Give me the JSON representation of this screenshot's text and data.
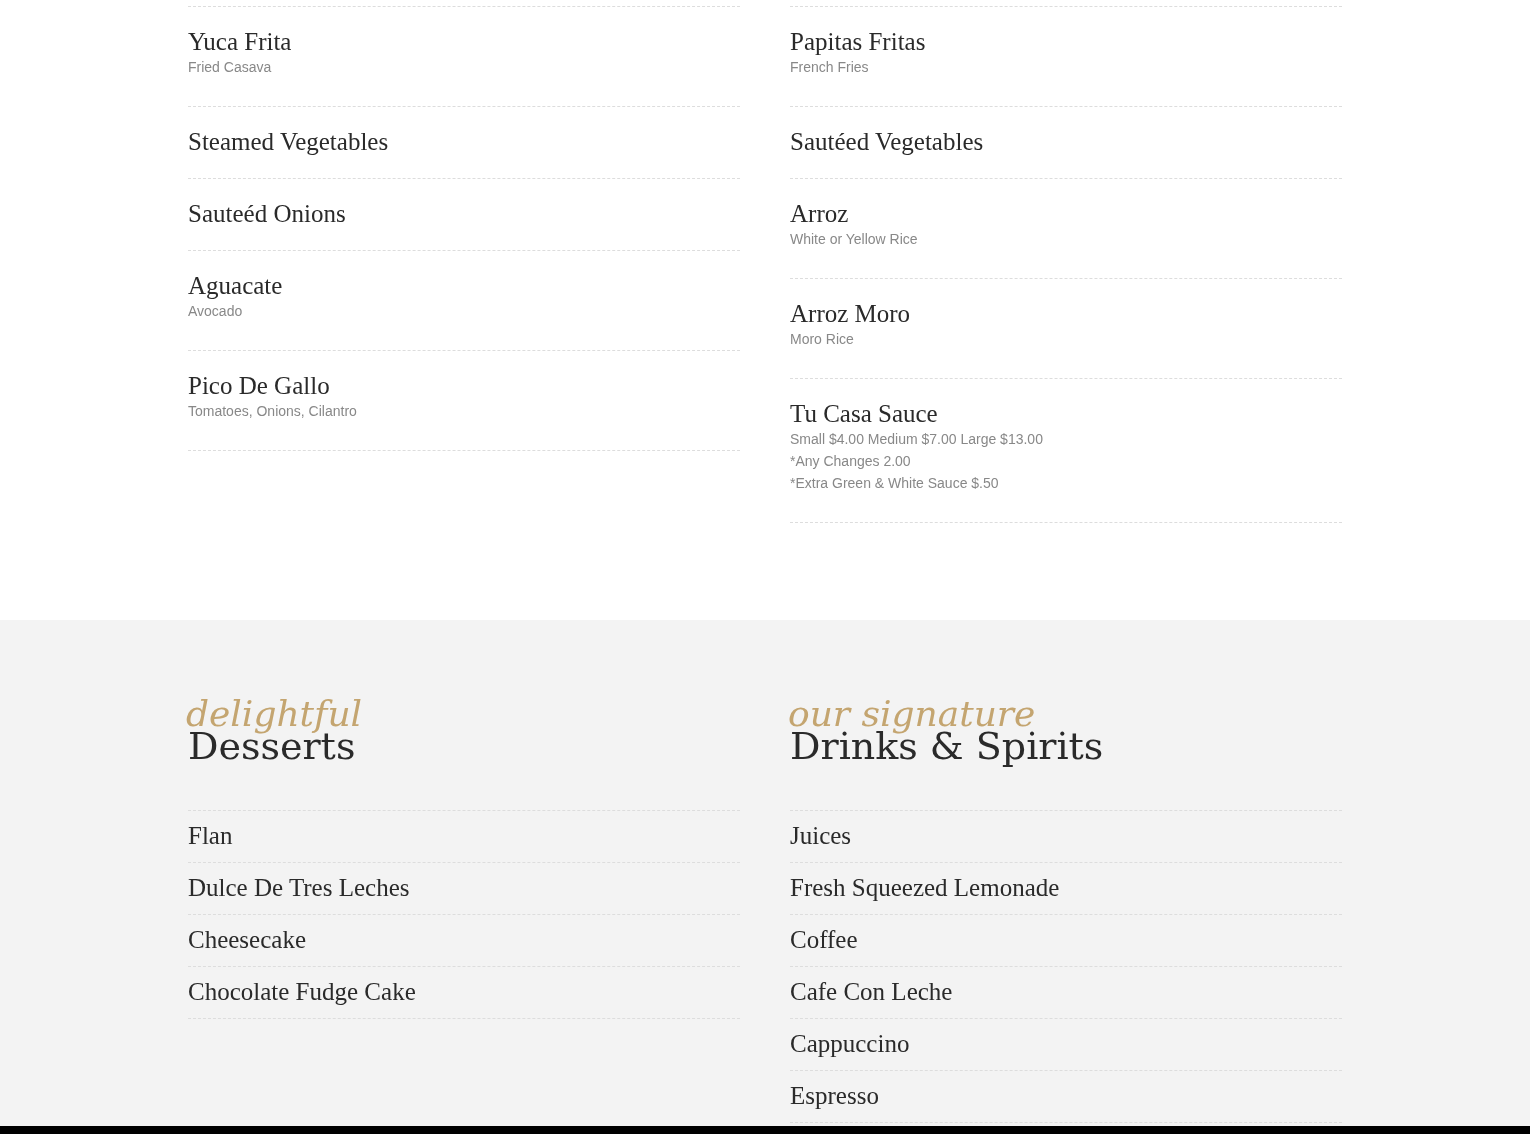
{
  "sides": {
    "columns": [
      {
        "items": [
          {
            "name": "Yuca Frita",
            "description": [
              "Fried Casava"
            ]
          },
          {
            "name": "Steamed Vegetables"
          },
          {
            "name": "Sauteéd Onions"
          },
          {
            "name": "Aguacate",
            "description": [
              "Avocado"
            ]
          },
          {
            "name": "Pico De Gallo",
            "description": [
              "Tomatoes, Onions, Cilantro"
            ]
          }
        ]
      },
      {
        "items": [
          {
            "name": "Papitas Fritas",
            "description": [
              "French Fries"
            ]
          },
          {
            "name": "Sautéed Vegetables"
          },
          {
            "name": "Arroz",
            "description": [
              "White or Yellow Rice"
            ]
          },
          {
            "name": "Arroz Moro",
            "description": [
              "Moro Rice"
            ]
          },
          {
            "name": "Tu Casa Sauce",
            "description": [
              "Small $4.00 Medium $7.00 Large $13.00",
              "*Any Changes 2.00",
              "*Extra Green & White Sauce $.50"
            ]
          }
        ]
      }
    ]
  },
  "menus": [
    {
      "tagline": "delightful",
      "title": "Desserts",
      "items": [
        "Flan",
        "Dulce De Tres Leches",
        "Cheesecake",
        "Chocolate Fudge Cake"
      ]
    },
    {
      "tagline": "our signature",
      "title": "Drinks & Spirits",
      "items": [
        "Juices",
        "Fresh Squeezed Lemonade",
        "Coffee",
        "Cafe Con Leche",
        "Cappuccino",
        "Espresso"
      ]
    }
  ]
}
